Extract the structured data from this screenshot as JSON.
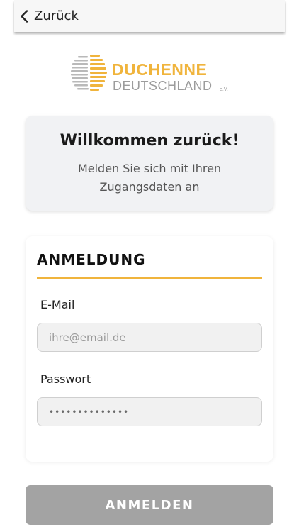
{
  "header": {
    "back_label": "Zurück",
    "back_icon": "chevron-left-icon"
  },
  "logo": {
    "line1": "DUCHENNE",
    "line2": "DEUTSCHLAND",
    "suffix": "e.V.",
    "primary_color": "#f0b43c",
    "secondary_color": "#9c9c9c"
  },
  "welcome": {
    "title": "Willkommen zurück!",
    "subtitle": "Melden Sie sich mit Ihren Zugangsdaten an"
  },
  "login": {
    "heading": "ANMELDUNG",
    "accent_color": "#f0b43c",
    "email": {
      "label": "E-Mail",
      "placeholder": "ihre@email.de",
      "value": ""
    },
    "password": {
      "label": "Passwort",
      "masked_value": "••••••••••••••"
    },
    "submit_label": "ANMELDEN",
    "submit_color": "#a3a3a3"
  }
}
